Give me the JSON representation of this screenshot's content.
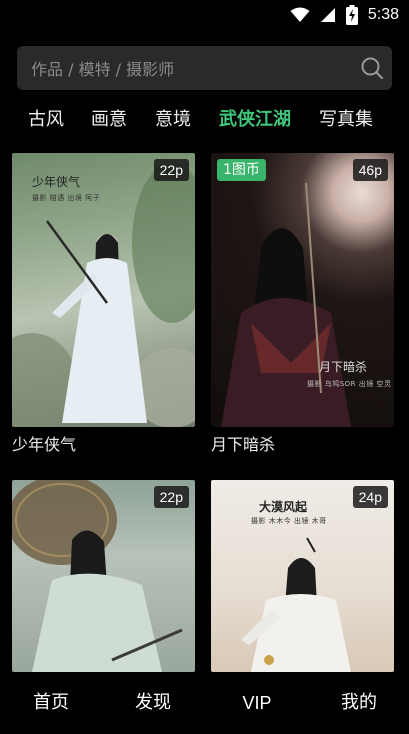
{
  "status_bar": {
    "time": "5:38",
    "icons": [
      "wifi-icon",
      "signal-icon",
      "battery-charging-icon"
    ]
  },
  "search": {
    "placeholder": "作品 / 模特 / 摄影师",
    "icon": "search-icon"
  },
  "tabs": [
    {
      "label": "古风",
      "active": false
    },
    {
      "label": "画意",
      "active": false
    },
    {
      "label": "意境",
      "active": false
    },
    {
      "label": "武侠江湖",
      "active": true
    },
    {
      "label": "写真集",
      "active": false
    }
  ],
  "colors": {
    "accent": "#3ec77c",
    "background": "#000000",
    "coin_badge": "#38b46b"
  },
  "cards": [
    {
      "title": "少年侠气",
      "count": "22p",
      "cover_title": "少年侠气",
      "cover_credits": "摄影 陪遇 出境 阿子"
    },
    {
      "title": "月下暗杀",
      "count": "46p",
      "coin_badge": "1图币",
      "cover_title": "月下暗杀",
      "cover_credits": "摄影 乌鸠SOR 出镜 空灵"
    },
    {
      "title": "",
      "count": "22p"
    },
    {
      "title": "",
      "count": "24p",
      "cover_title": "大漠风起",
      "cover_credits": "摄影 木木今 出镜 木哥"
    }
  ],
  "bottom_nav": [
    {
      "label": "首页"
    },
    {
      "label": "发现"
    },
    {
      "label": "VIP"
    },
    {
      "label": "我的"
    }
  ]
}
